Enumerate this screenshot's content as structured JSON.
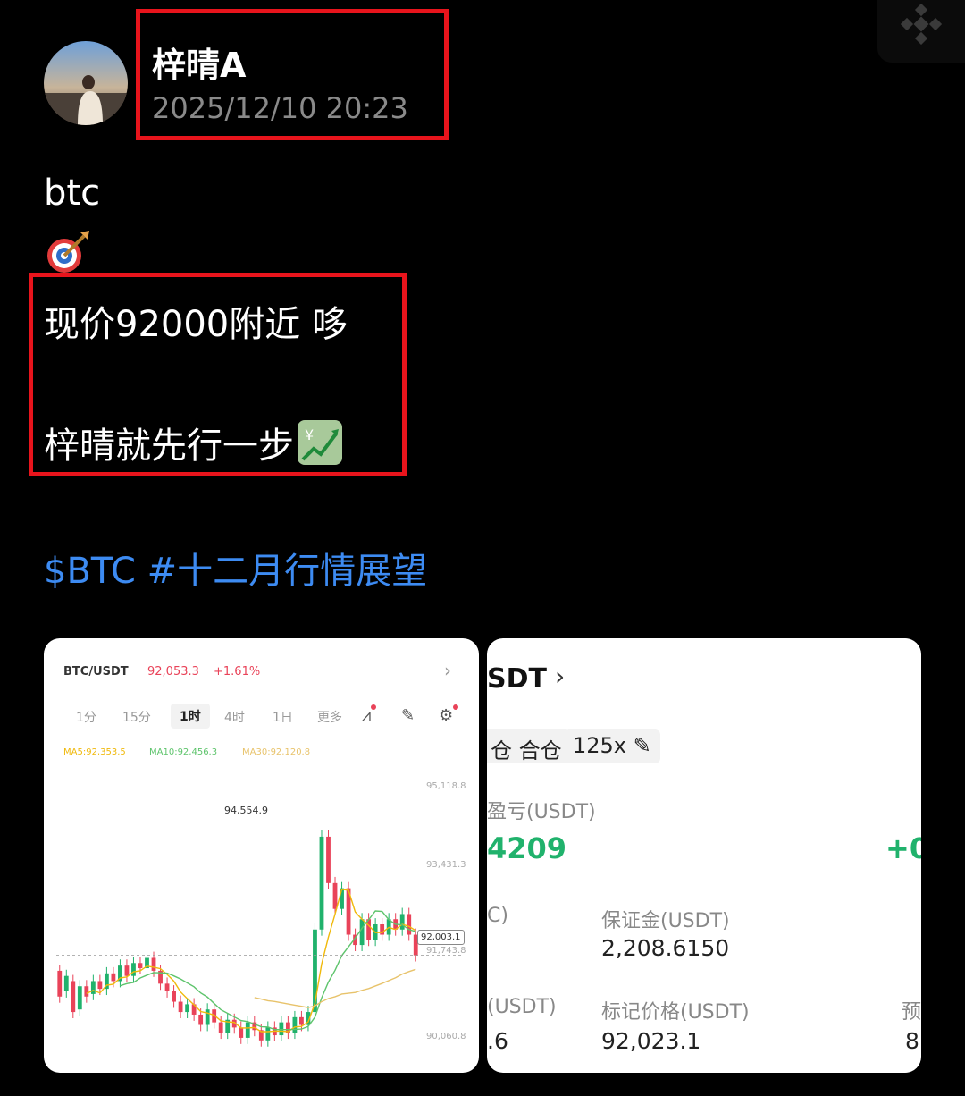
{
  "post": {
    "author_name": "梓晴A",
    "timestamp": "2025/12/10 20:23",
    "line_btc": "btc",
    "line_price": "现价92000附近 哆",
    "line_step": "梓晴就先行一步",
    "tag_symbol": "$BTC",
    "tag_topic": "#十二月行情展望",
    "icons": [
      "avatar-photo",
      "direct-hit-emoji",
      "chart-yen-emoji",
      "binance-logo-icon"
    ]
  },
  "chart_card": {
    "pair": "BTC/USDT",
    "price": "92,053.3",
    "change": "+1.61%",
    "arrow": "›",
    "timeframes": [
      "1分",
      "15分",
      "1时",
      "4时",
      "1日",
      "更多"
    ],
    "active_timeframe": "1时",
    "ma5": "MA5:92,353.5",
    "ma10": "MA10:92,456.3",
    "ma30": "MA30:92,120.8",
    "high_label": "94,554.9",
    "current_price_box": "92,003.1",
    "y_ticks": [
      "95,118.8",
      "93,431.3",
      "91,743.8",
      "90,060.8"
    ],
    "colors": {
      "up": "#20b26c",
      "down": "#e94359",
      "ma5": "#f0b90b",
      "ma10": "#5ec46c",
      "ma30": "#e8c36b"
    }
  },
  "chart_data": {
    "type": "candlestick",
    "title": "BTC/USDT",
    "ylabel": "",
    "ylim": [
      90000,
      95200
    ],
    "candles": [
      [
        91700,
        91200
      ],
      [
        91300,
        91600
      ],
      [
        91500,
        90900
      ],
      [
        90950,
        91400
      ],
      [
        91400,
        91200
      ],
      [
        91250,
        91500
      ],
      [
        91500,
        91350
      ],
      [
        91350,
        91650
      ],
      [
        91650,
        91500
      ],
      [
        91500,
        91800
      ],
      [
        91800,
        91600
      ],
      [
        91600,
        91850
      ],
      [
        91850,
        91750
      ],
      [
        91750,
        91950
      ],
      [
        91950,
        91700
      ],
      [
        91700,
        91450
      ],
      [
        91450,
        91300
      ],
      [
        91300,
        91100
      ],
      [
        91100,
        90900
      ],
      [
        90900,
        91050
      ],
      [
        91050,
        90850
      ],
      [
        90850,
        90650
      ],
      [
        90650,
        90950
      ],
      [
        90950,
        90700
      ],
      [
        90700,
        90500
      ],
      [
        90500,
        90750
      ],
      [
        90750,
        90600
      ],
      [
        90600,
        90400
      ],
      [
        90400,
        90700
      ],
      [
        90700,
        90550
      ],
      [
        90550,
        90350
      ],
      [
        90350,
        90600
      ],
      [
        90600,
        90450
      ],
      [
        90450,
        90700
      ],
      [
        90700,
        90500
      ],
      [
        90500,
        90800
      ],
      [
        90800,
        90650
      ],
      [
        90650,
        90900
      ],
      [
        90900,
        92500
      ],
      [
        92500,
        94300
      ],
      [
        94300,
        93400
      ],
      [
        93400,
        92900
      ],
      [
        92900,
        93300
      ],
      [
        93300,
        92400
      ],
      [
        92400,
        92200
      ],
      [
        92200,
        92700
      ],
      [
        92700,
        92300
      ],
      [
        92300,
        92600
      ],
      [
        92600,
        92400
      ],
      [
        92400,
        92700
      ],
      [
        92700,
        92500
      ],
      [
        92500,
        92800
      ],
      [
        92800,
        92400
      ],
      [
        92400,
        92000
      ]
    ]
  },
  "position_card": {
    "title": "SDT",
    "chevron": "›",
    "chip_margin": "仓 合仓",
    "chip_leverage": "125x",
    "pnl_label": "盈亏(USDT)",
    "pnl_value": "4209",
    "pnl_right": "+0",
    "label_left1": "C)",
    "margin_label": "保证金(USDT)",
    "margin_value": "2,208.6150",
    "label_left2": "(USDT)",
    "value_left2": ".6",
    "mark_label": "标记价格(USDT)",
    "mark_value": "92,023.1",
    "label_right": "预",
    "value_right": "8"
  }
}
